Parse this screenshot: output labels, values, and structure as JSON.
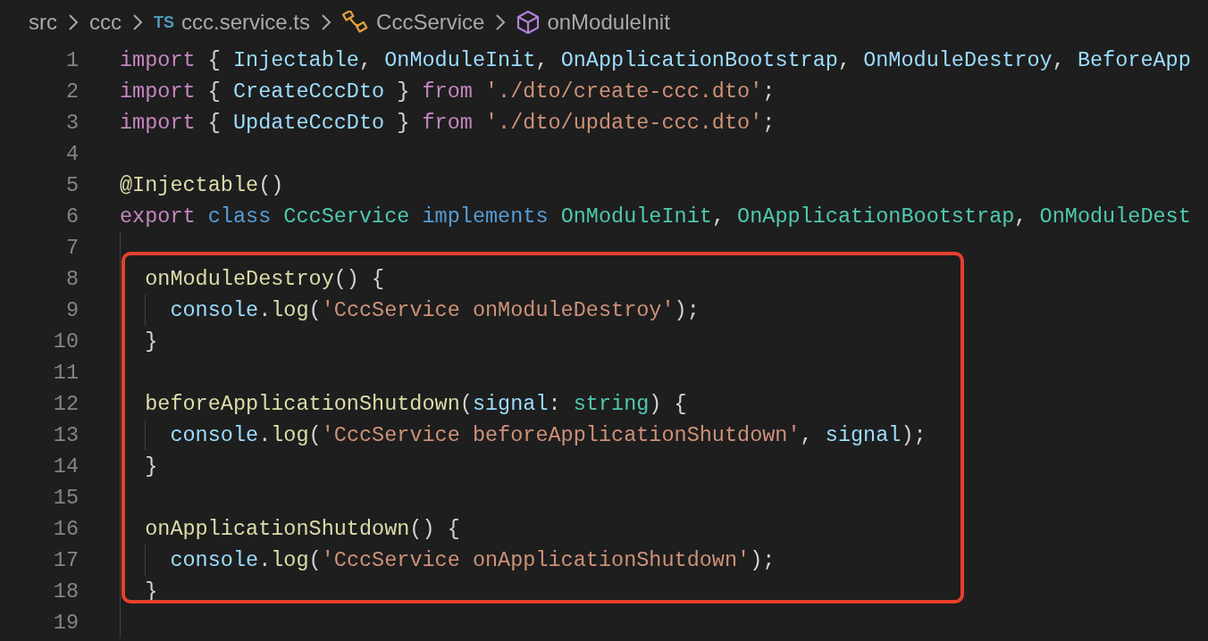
{
  "breadcrumbs": [
    {
      "text": "src",
      "kind": "folder"
    },
    {
      "text": "ccc",
      "kind": "folder"
    },
    {
      "text": "ccc.service.ts",
      "kind": "file",
      "badge": "TS"
    },
    {
      "text": "CccService",
      "kind": "class"
    },
    {
      "text": "onModuleInit",
      "kind": "method"
    }
  ],
  "segments": [
    {
      "boxed": false,
      "lines": [
        {
          "number": "1",
          "tokens": [
            {
              "t": "import",
              "kind": "control"
            },
            {
              "t": " { ",
              "kind": "punct"
            },
            {
              "t": "Injectable",
              "kind": "var"
            },
            {
              "t": ", ",
              "kind": "punct"
            },
            {
              "t": "OnModuleInit",
              "kind": "var"
            },
            {
              "t": ", ",
              "kind": "punct"
            },
            {
              "t": "OnApplicationBootstrap",
              "kind": "var"
            },
            {
              "t": ", ",
              "kind": "punct"
            },
            {
              "t": "OnModuleDestroy",
              "kind": "var"
            },
            {
              "t": ", ",
              "kind": "punct"
            },
            {
              "t": "BeforeApp",
              "kind": "var"
            }
          ]
        },
        {
          "number": "2",
          "tokens": [
            {
              "t": "import",
              "kind": "control"
            },
            {
              "t": " { ",
              "kind": "punct"
            },
            {
              "t": "CreateCccDto",
              "kind": "var"
            },
            {
              "t": " } ",
              "kind": "punct"
            },
            {
              "t": "from",
              "kind": "control"
            },
            {
              "t": " './dto/create-ccc.dto'",
              "kind": "string"
            },
            {
              "t": ";",
              "kind": "punct"
            }
          ]
        },
        {
          "number": "3",
          "tokens": [
            {
              "t": "import",
              "kind": "control"
            },
            {
              "t": " { ",
              "kind": "punct"
            },
            {
              "t": "UpdateCccDto",
              "kind": "var"
            },
            {
              "t": " } ",
              "kind": "punct"
            },
            {
              "t": "from",
              "kind": "control"
            },
            {
              "t": " './dto/update-ccc.dto'",
              "kind": "string"
            },
            {
              "t": ";",
              "kind": "punct"
            }
          ]
        },
        {
          "number": "4"
        },
        {
          "number": "5",
          "tokens": [
            {
              "t": "@Injectable",
              "kind": "fn"
            },
            {
              "t": "()",
              "kind": "punct"
            }
          ]
        },
        {
          "number": "6",
          "tokens": [
            {
              "t": "export",
              "kind": "control"
            },
            {
              "t": " class",
              "kind": "keyword"
            },
            {
              "t": " CccService",
              "kind": "type"
            },
            {
              "t": " implements",
              "kind": "keyword"
            },
            {
              "t": " OnModuleInit",
              "kind": "type"
            },
            {
              "t": ", ",
              "kind": "punct"
            },
            {
              "t": "OnApplicationBootstrap",
              "kind": "type"
            },
            {
              "t": ", ",
              "kind": "punct"
            },
            {
              "t": "OnModuleDest",
              "kind": "type"
            }
          ]
        },
        {
          "number": "7"
        }
      ]
    },
    {
      "boxed": true,
      "lines": [
        {
          "number": "8",
          "tokens": [
            {
              "t": "  onModuleDestroy",
              "kind": "fn"
            },
            {
              "t": "() {",
              "kind": "punct"
            }
          ]
        },
        {
          "number": "9",
          "tokens": [
            {
              "t": "    console",
              "kind": "var"
            },
            {
              "t": ".",
              "kind": "punct"
            },
            {
              "t": "log",
              "kind": "fn"
            },
            {
              "t": "(",
              "kind": "punct"
            },
            {
              "t": "'CccService onModuleDestroy'",
              "kind": "string"
            },
            {
              "t": ");",
              "kind": "punct"
            }
          ]
        },
        {
          "number": "10",
          "tokens": [
            {
              "t": "  }",
              "kind": "punct"
            }
          ]
        },
        {
          "number": "11"
        },
        {
          "number": "12",
          "tokens": [
            {
              "t": "  beforeApplicationShutdown",
              "kind": "fn"
            },
            {
              "t": "(",
              "kind": "punct"
            },
            {
              "t": "signal",
              "kind": "var"
            },
            {
              "t": ": ",
              "kind": "punct"
            },
            {
              "t": "string",
              "kind": "type"
            },
            {
              "t": ") {",
              "kind": "punct"
            }
          ]
        },
        {
          "number": "13",
          "tokens": [
            {
              "t": "    console",
              "kind": "var"
            },
            {
              "t": ".",
              "kind": "punct"
            },
            {
              "t": "log",
              "kind": "fn"
            },
            {
              "t": "(",
              "kind": "punct"
            },
            {
              "t": "'CccService beforeApplicationShutdown'",
              "kind": "string"
            },
            {
              "t": ", ",
              "kind": "punct"
            },
            {
              "t": "signal",
              "kind": "var"
            },
            {
              "t": ");",
              "kind": "punct"
            }
          ]
        },
        {
          "number": "14",
          "tokens": [
            {
              "t": "  }",
              "kind": "punct"
            }
          ]
        },
        {
          "number": "15"
        },
        {
          "number": "16",
          "tokens": [
            {
              "t": "  onApplicationShutdown",
              "kind": "fn"
            },
            {
              "t": "() {",
              "kind": "punct"
            }
          ]
        },
        {
          "number": "17",
          "tokens": [
            {
              "t": "    console",
              "kind": "var"
            },
            {
              "t": ".",
              "kind": "punct"
            },
            {
              "t": "log",
              "kind": "fn"
            },
            {
              "t": "(",
              "kind": "punct"
            },
            {
              "t": "'CccService onApplicationShutdown'",
              "kind": "string"
            },
            {
              "t": ");",
              "kind": "punct"
            }
          ]
        },
        {
          "number": "18",
          "tokens": [
            {
              "t": "  }",
              "kind": "punct"
            }
          ]
        }
      ]
    },
    {
      "boxed": false,
      "lines": [
        {
          "number": "19"
        }
      ]
    }
  ]
}
